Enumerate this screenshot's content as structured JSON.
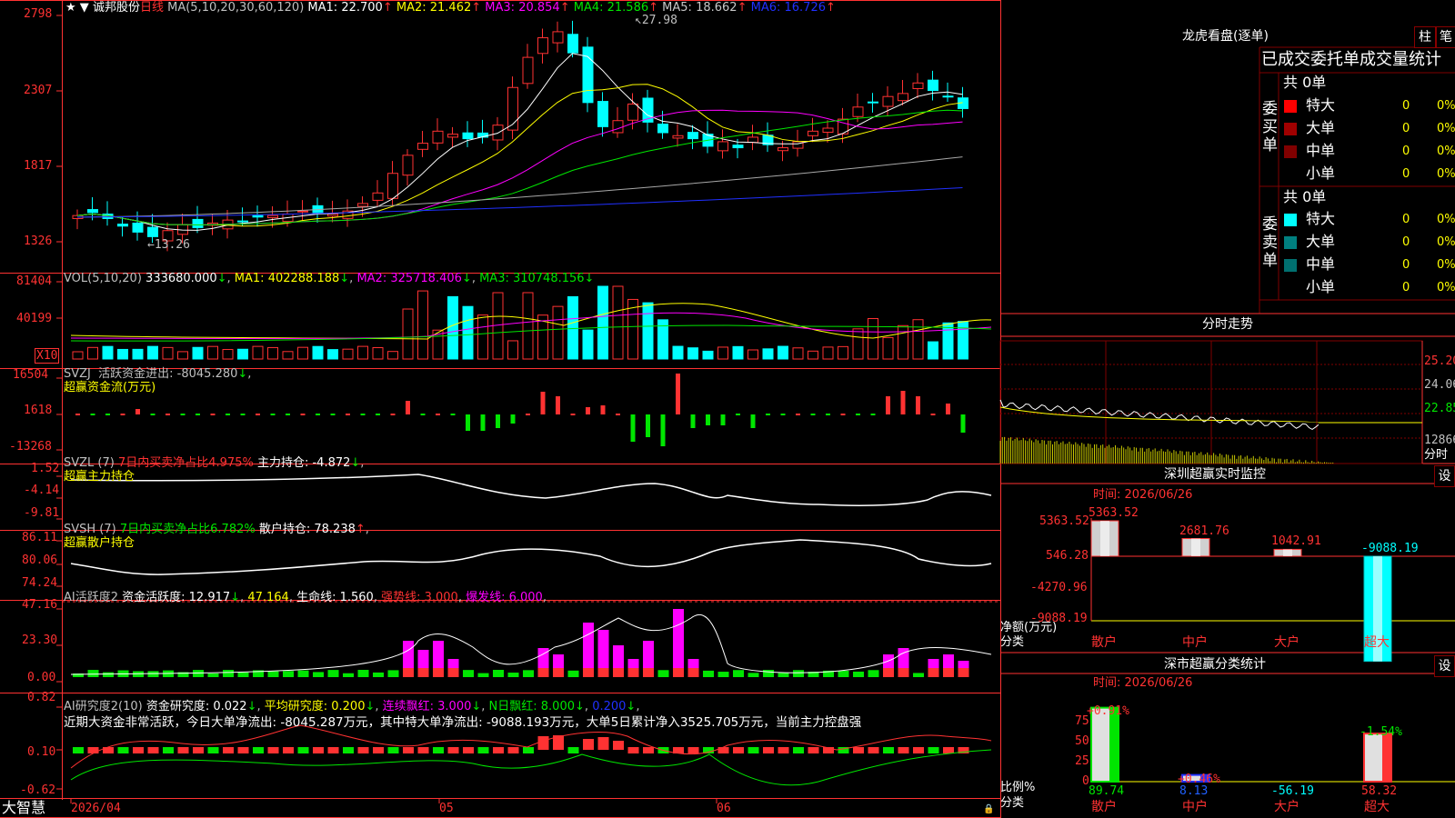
{
  "colors": {
    "up": "#ff3232",
    "down": "#00ffff",
    "bg": "#000000",
    "grid": "#800000",
    "axis": "#ff3232",
    "white": "#ffffff",
    "yellow": "#ffff00",
    "magenta": "#ff00ff",
    "green": "#00e600",
    "gray": "#a8a8a8",
    "blue": "#2030ff"
  },
  "main": {
    "header": {
      "star": "★ ▼",
      "name": "诚邦股份",
      "period": "日线",
      "ma_label": "MA(5,10,20,30,60,120)",
      "ma": [
        {
          "t": "MA1: 22.700",
          "a": "↑"
        },
        {
          "t": "MA2: 21.462",
          "a": "↑"
        },
        {
          "t": "MA3: 20.854",
          "a": "↑"
        },
        {
          "t": "MA4: 21.586",
          "a": "↑"
        },
        {
          "t": "MA5: 18.662",
          "a": "↑"
        },
        {
          "t": "MA6: 16.726",
          "a": "↑"
        }
      ]
    },
    "yticks": [
      "2798",
      "2307",
      "1817",
      "1326"
    ],
    "hi_label": "27.98",
    "lo_label": "13.26"
  },
  "vol": {
    "header": {
      "label": "VOL(5,10,20)",
      "v": "333680.000",
      "ma1": "MA1: 402288.188",
      "ma2": "MA2: 325718.406",
      "ma3": "MA3: 310748.156"
    },
    "yticks": [
      "81404",
      "40199"
    ],
    "unit": "X10"
  },
  "svzj": {
    "header": {
      "name": "SVZJ",
      "l1": "活跃资金进出: -8045.280",
      "l2": "超赢资金流(万元)"
    },
    "yticks": [
      "16504",
      "1618",
      "-13268"
    ]
  },
  "svzl": {
    "header": {
      "name": "SVZL (7)",
      "l1": "7日内买卖净占比4.975%",
      "l2": "主力持仓: -4.872",
      "l3": "超赢主力持仓"
    },
    "yticks": [
      "1.52",
      "-4.14",
      "-9.81"
    ]
  },
  "svsh": {
    "header": {
      "name": "SVSH (7)",
      "l1": "7日内买卖净占比6.782%",
      "l2": "散户持仓: 78.238",
      "l3": "超赢散户持仓"
    },
    "yticks": [
      "86.11",
      "80.06",
      "74.24"
    ]
  },
  "ai1": {
    "header": {
      "name": "AI活跃度2",
      "l1": "资金活跃度: 12.917",
      "l2": "47.164",
      "l3": "生命线: 1.560",
      "l4": "强势线: 3.000",
      "l5": "爆发线: 6.000"
    },
    "yticks": [
      "47.16",
      "23.30",
      "0.00"
    ]
  },
  "ai2": {
    "header": {
      "name": "AI研究度2(10)",
      "l1": "资金研究度: 0.022",
      "l2": "平均研究度: 0.200",
      "l3": "连续飘红: 3.000",
      "l4": "N日飘红: 8.000",
      "l5": "0.200"
    },
    "comment": "近期大资金非常活跃，今日大单净流出: -8045.287万元，其中特大单净流出: -9088.193万元，大单5日累计净入3525.705万元，当前主力控盘强",
    "yticks": [
      "0.82",
      "0.10",
      "-0.62"
    ]
  },
  "xaxis": {
    "labels": [
      "2026/04",
      "05",
      "06"
    ],
    "brand": "大智慧"
  },
  "dragon": {
    "title": "龙虎看盘(逐单)",
    "btn1": "柱",
    "btn2": "笔",
    "subtitle": "已成交委托单成交量统计",
    "buy": {
      "side": "委买单",
      "total": "共 0单",
      "rows": [
        {
          "n": "特大",
          "v": "0",
          "p": "0%",
          "c": "#ff0000"
        },
        {
          "n": "大单",
          "v": "0",
          "p": "0%",
          "c": "#a00000"
        },
        {
          "n": "中单",
          "v": "0",
          "p": "0%",
          "c": "#800000"
        },
        {
          "n": "小单",
          "v": "0",
          "p": "0%",
          "c": ""
        }
      ]
    },
    "sell": {
      "side": "委卖单",
      "total": "共 0单",
      "rows": [
        {
          "n": "特大",
          "v": "0",
          "p": "0%",
          "c": "#00ffff"
        },
        {
          "n": "大单",
          "v": "0",
          "p": "0%",
          "c": "#008080"
        },
        {
          "n": "中单",
          "v": "0",
          "p": "0%",
          "c": "#007070"
        },
        {
          "n": "小单",
          "v": "0",
          "p": "0%",
          "c": ""
        }
      ]
    }
  },
  "intraday": {
    "title": "分时走势",
    "yticks": [
      "25.20",
      "24.06",
      "22.85",
      "12866"
    ],
    "unit": "分时"
  },
  "sz_monitor": {
    "title": "深圳超赢实时监控",
    "btn": "设",
    "time": "时间: 2026/06/26",
    "yticks": [
      "5363.52",
      "546.28",
      "-4270.96",
      "-9088.19"
    ],
    "ylabel": "净额(万元)",
    "xlabel": "分类",
    "categories": [
      "散户",
      "中户",
      "大户",
      "超大"
    ],
    "values": [
      "5363.52",
      "2681.76",
      "1042.91",
      "-9088.19"
    ]
  },
  "sz_class": {
    "title": "深市超赢分类统计",
    "btn": "设",
    "time": "时间: 2026/06/26",
    "yticks": [
      "75",
      "50",
      "25",
      "0"
    ],
    "ylabel": "比例%",
    "xlabel": "分类",
    "categories": [
      "散户",
      "中户",
      "大户",
      "超大"
    ],
    "tops": [
      "+0.91%",
      "+0.46%",
      "",
      "-1.54%"
    ],
    "values": [
      "89.74",
      "8.13",
      "-56.19",
      "58.32"
    ]
  },
  "chart_data": {
    "type": "candlestick",
    "title": "诚邦股份 日线",
    "ylim": [
      13.26,
      27.98
    ],
    "x": [
      "2026/04",
      "05",
      "06"
    ],
    "ma": {
      "MA1": 22.7,
      "MA2": 21.462,
      "MA3": 20.854,
      "MA4": 21.586,
      "MA5": 18.662,
      "MA6": 16.726
    },
    "volume": {
      "VOL": 333680.0,
      "MA1": 402288.188,
      "MA2": 325718.406,
      "MA3": 310748.156
    }
  }
}
